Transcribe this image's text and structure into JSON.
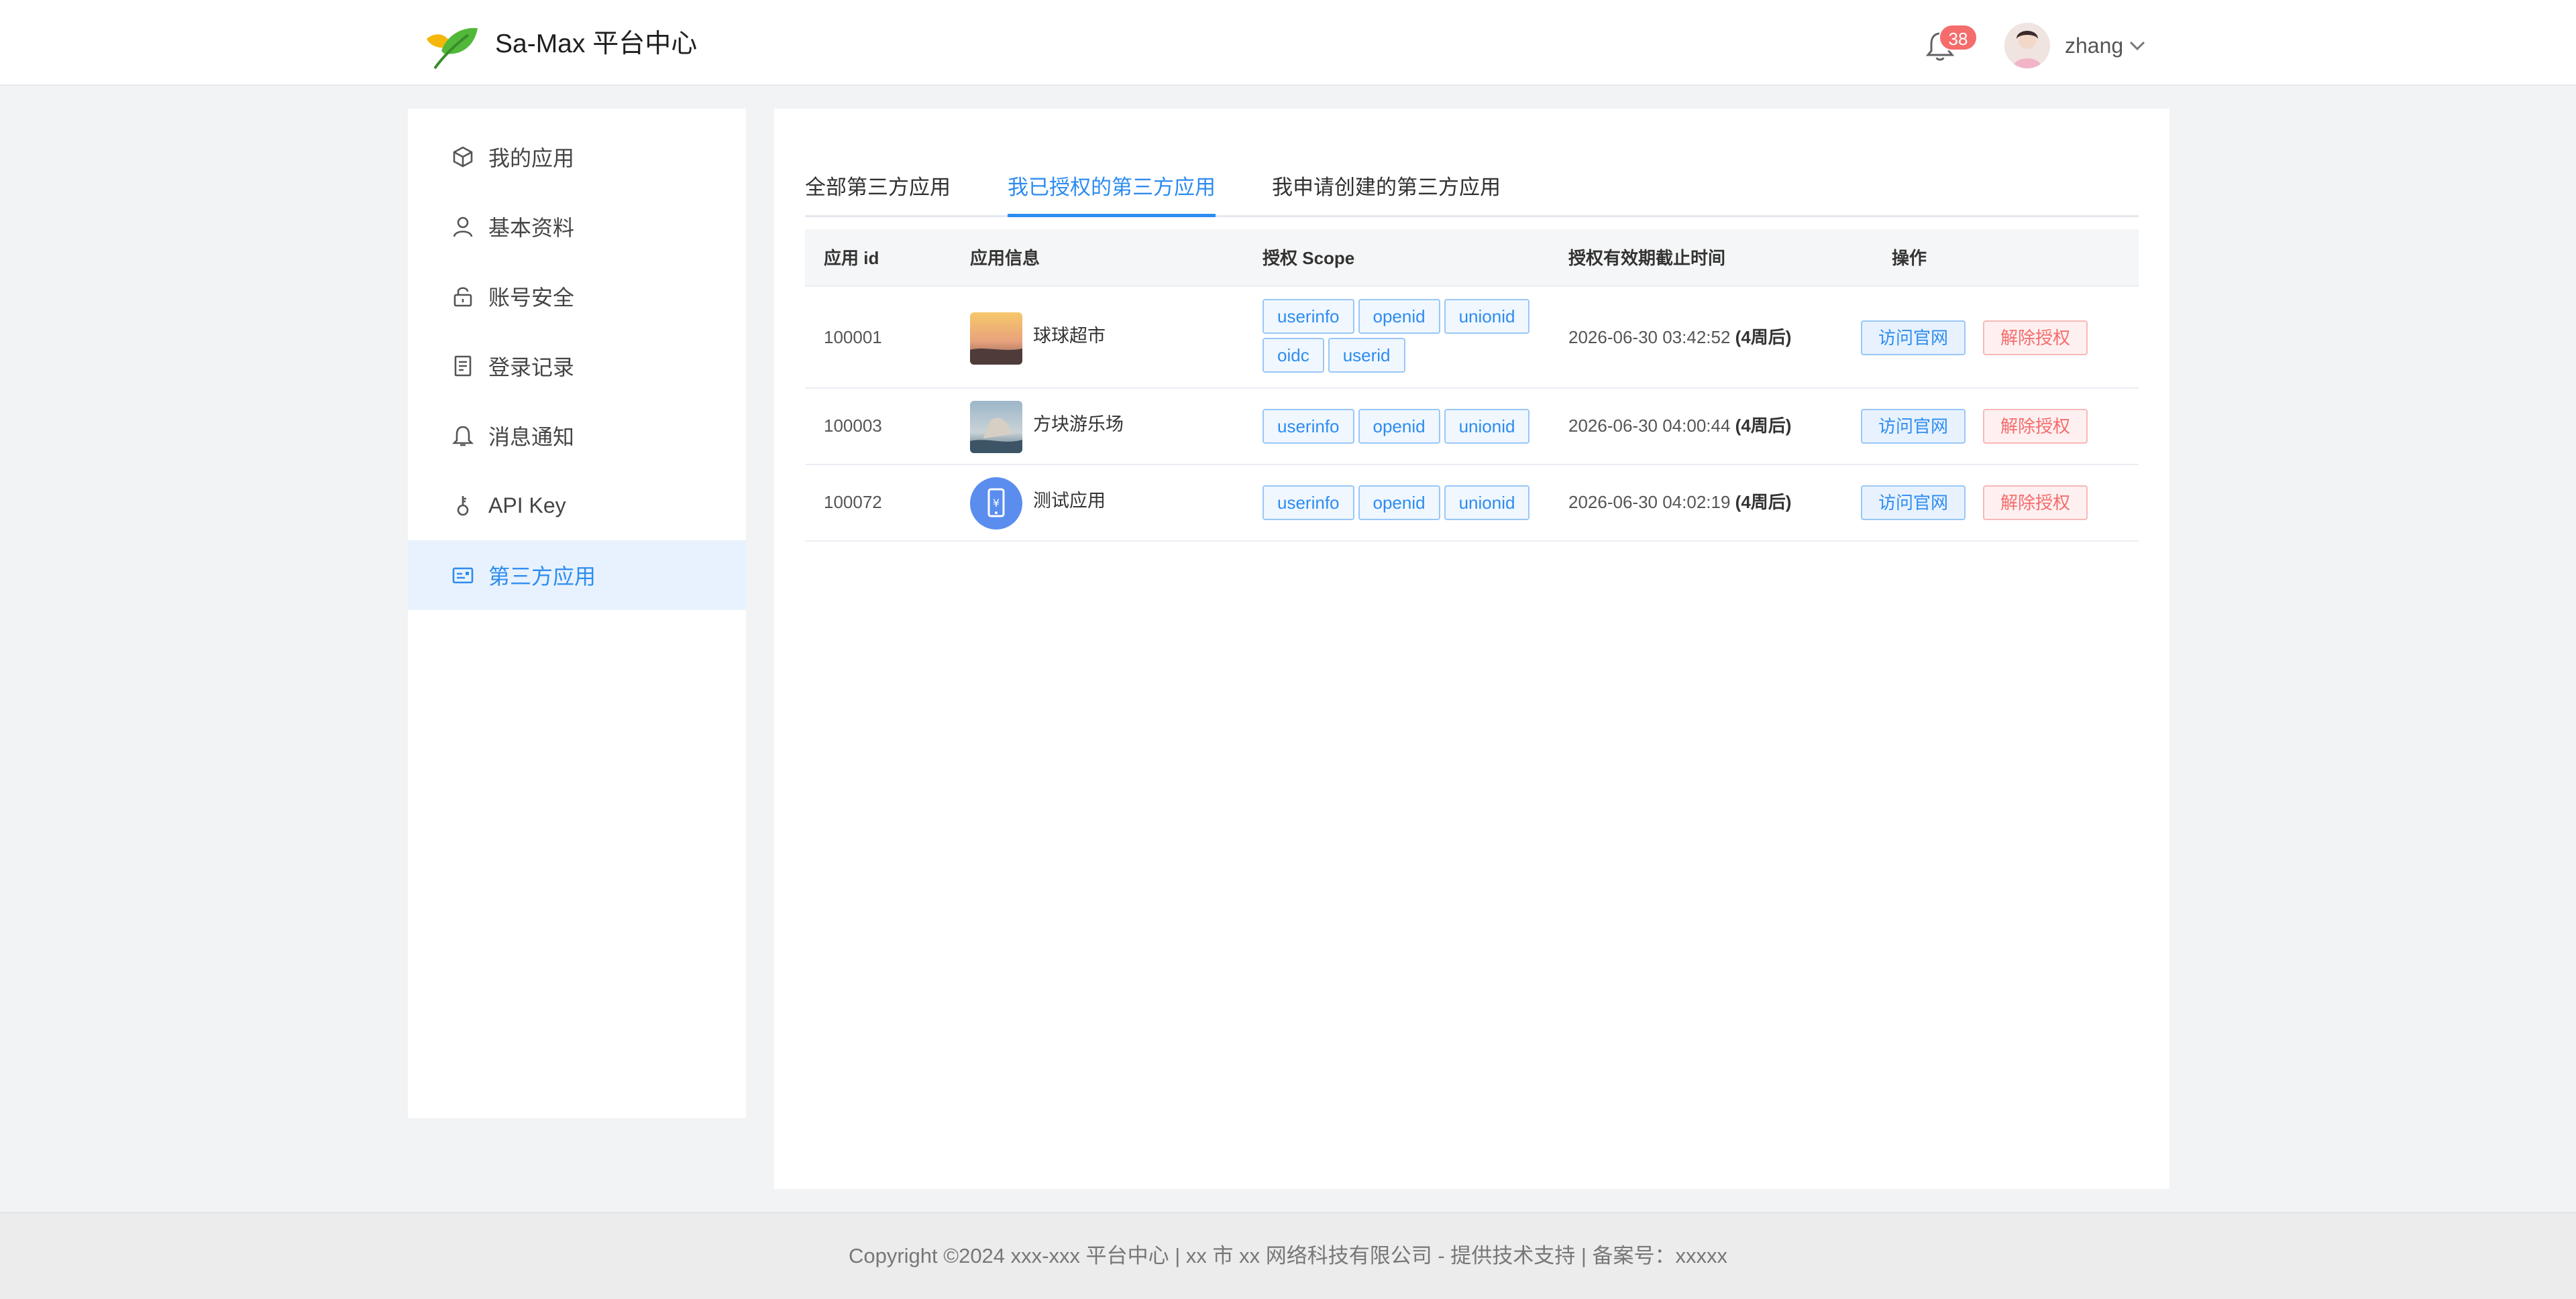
{
  "header": {
    "brand": "Sa-Max 平台中心",
    "notification_count": "38",
    "username": "zhang"
  },
  "sidebar": {
    "items": [
      {
        "label": "我的应用",
        "icon": "cube-icon"
      },
      {
        "label": "基本资料",
        "icon": "user-icon"
      },
      {
        "label": "账号安全",
        "icon": "lock-icon"
      },
      {
        "label": "登录记录",
        "icon": "document-icon"
      },
      {
        "label": "消息通知",
        "icon": "bell-icon"
      },
      {
        "label": "API Key",
        "icon": "key-icon"
      },
      {
        "label": "第三方应用",
        "icon": "id-card-icon"
      }
    ],
    "active_index": 6
  },
  "tabs": [
    {
      "label": "全部第三方应用"
    },
    {
      "label": "我已授权的第三方应用"
    },
    {
      "label": "我申请创建的第三方应用"
    }
  ],
  "active_tab": 1,
  "table": {
    "headers": [
      "应用 id",
      "应用信息",
      "授权 Scope",
      "授权有效期截止时间",
      "操作"
    ],
    "rows": [
      {
        "id": "100001",
        "name": "球球超市",
        "scopes": [
          "userinfo",
          "openid",
          "unionid",
          "oidc",
          "userid"
        ],
        "expire": "2026-06-30 03:42:52",
        "remain": "(4周后)",
        "visit": "访问官网",
        "revoke": "解除授权"
      },
      {
        "id": "100003",
        "name": "方块游乐场",
        "scopes": [
          "userinfo",
          "openid",
          "unionid"
        ],
        "expire": "2026-06-30 04:00:44",
        "remain": "(4周后)",
        "visit": "访问官网",
        "revoke": "解除授权"
      },
      {
        "id": "100072",
        "name": "测试应用",
        "scopes": [
          "userinfo",
          "openid",
          "unionid"
        ],
        "expire": "2026-06-30 04:02:19",
        "remain": "(4周后)",
        "visit": "访问官网",
        "revoke": "解除授权"
      }
    ]
  },
  "colors": {
    "accent": "#2d8cf0",
    "danger": "#f56c6c",
    "background": "#f2f3f5"
  },
  "footer": {
    "copyright": "Copyright ©2024 xxx-xxx 平台中心 | xx 市 xx 网络科技有限公司 - 提供技术支持 | 备案号：xxxxx"
  }
}
